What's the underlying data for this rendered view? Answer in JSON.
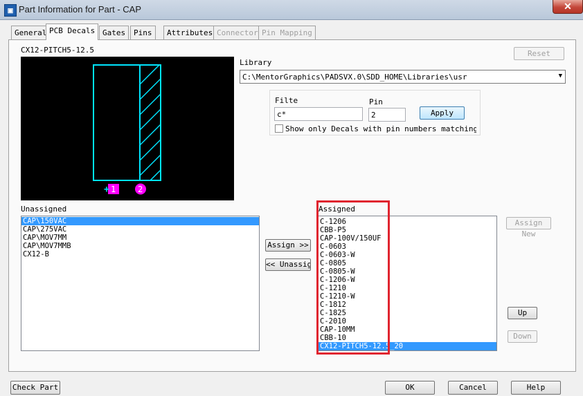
{
  "window": {
    "title": "Part Information for Part - CAP",
    "close_label": "✕"
  },
  "tabs": [
    {
      "label": "General",
      "state": "normal"
    },
    {
      "label": "PCB Decals",
      "state": "active"
    },
    {
      "label": "Gates",
      "state": "normal"
    },
    {
      "label": "Pins",
      "state": "normal"
    },
    {
      "label": "Attributes",
      "state": "normal"
    },
    {
      "label": "Connector",
      "state": "disabled"
    },
    {
      "label": "Pin Mapping",
      "state": "disabled"
    }
  ],
  "decal": {
    "name": "CX12-PITCH5-12.5",
    "pin1": "1",
    "pin2": "2",
    "pin1_marker": "+"
  },
  "reset_label": "Reset",
  "library": {
    "label": "Library",
    "value": "C:\\MentorGraphics\\PADSVX.0\\SDD_HOME\\Libraries\\usr"
  },
  "filter": {
    "filter_label": "Filte",
    "filter_value": "c*",
    "pin_label": "Pin",
    "pin_value": "2",
    "apply_label": "Apply",
    "checkbox_label": "Show only Decals with pin numbers matching Pa"
  },
  "unassigned": {
    "label": "Unassigned",
    "items": [
      "CAP\\150VAC",
      "CAP\\275VAC",
      "CAP\\MOV7MM",
      "CAP\\MOV7MMB",
      "CX12-B"
    ],
    "selected_index": 0
  },
  "assign_label": "Assign >>",
  "unassign_label": "<< Unassign",
  "assigned": {
    "label": "Assigned",
    "items": [
      "C-1206",
      "CBB-P5",
      "CAP-100V/150UF",
      "C-0603",
      "C-0603-W",
      "C-0805",
      "C-0805-W",
      "C-1206-W",
      "C-1210",
      "C-1210-W",
      "C-1812",
      "C-1825",
      "C-2010",
      "CAP-10MM",
      "CBB-10",
      "CX12-PITCH5-12.5_20"
    ],
    "selected_index": 15
  },
  "assign_new_label": "Assign New",
  "up_label": "Up",
  "down_label": "Down",
  "footer": {
    "check_part_label": "Check Part",
    "ok_label": "OK",
    "cancel_label": "Cancel",
    "help_label": "Help"
  },
  "colors": {
    "decal_outline": "#00e5ff",
    "pin_marker": "#ff00ff",
    "highlight_box": "#e0242f",
    "selection": "#3399ff"
  }
}
